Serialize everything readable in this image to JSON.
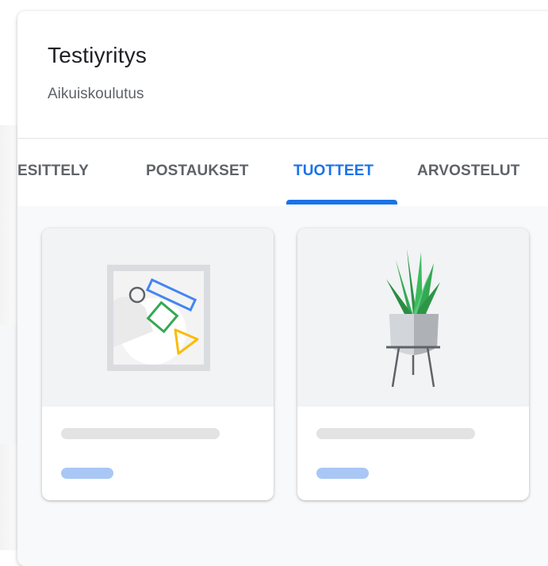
{
  "business": {
    "name": "Testiyritys",
    "category": "Aikuiskoulutus"
  },
  "tabs": [
    {
      "label": "ESITTELY",
      "active": false
    },
    {
      "label": "POSTAUKSET",
      "active": false
    },
    {
      "label": "TUOTTEET",
      "active": true
    },
    {
      "label": "ARVOSTELUT",
      "active": false
    }
  ],
  "products": [
    {
      "illustration": "abstract-shapes-image-icon"
    },
    {
      "illustration": "potted-plant-image-icon"
    }
  ],
  "colors": {
    "accent": "#1a73e8",
    "tab_text": "#5f6368",
    "title_text": "#202124",
    "placeholder_gray": "#e3e3e3",
    "placeholder_blue": "#a9c7f5"
  }
}
